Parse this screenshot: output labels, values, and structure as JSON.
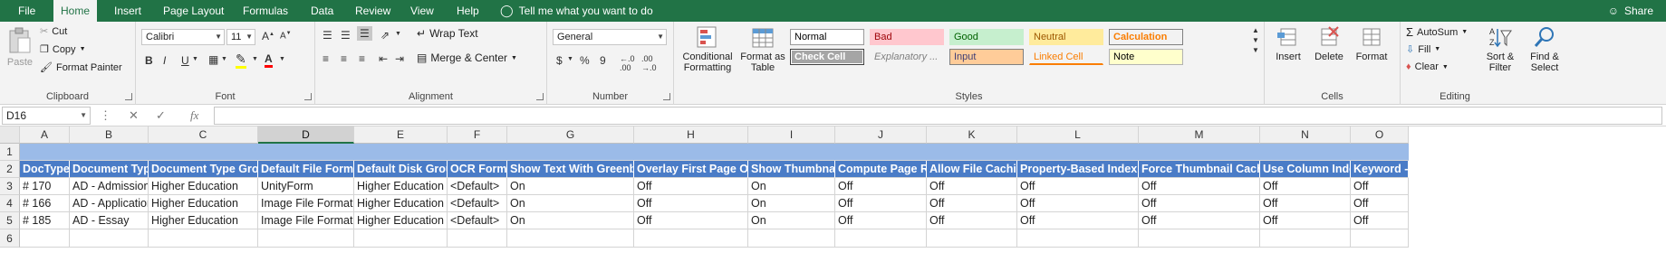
{
  "menu": {
    "tabs": [
      "File",
      "Home",
      "Insert",
      "Page Layout",
      "Formulas",
      "Data",
      "Review",
      "View",
      "Help"
    ],
    "active": "Home",
    "tell_me": "Tell me what you want to do",
    "share": "Share"
  },
  "ribbon": {
    "clipboard": {
      "label": "Clipboard",
      "paste": "Paste",
      "cut": "Cut",
      "copy": "Copy",
      "format_painter": "Format Painter"
    },
    "font": {
      "label": "Font",
      "font_name": "Calibri",
      "font_size": "11",
      "bold": "B",
      "italic": "I",
      "underline": "U"
    },
    "alignment": {
      "label": "Alignment",
      "wrap_text": "Wrap Text",
      "merge_center": "Merge & Center"
    },
    "number": {
      "label": "Number",
      "format": "General",
      "currency": "$",
      "percent": "%",
      "comma": "9"
    },
    "styles": {
      "label": "Styles",
      "conditional_formatting": "Conditional Formatting",
      "format_as_table": "Format as Table",
      "cells": [
        {
          "name": "Normal",
          "bg": "#ffffff",
          "fg": "#000000",
          "border": "#9a9a9a"
        },
        {
          "name": "Bad",
          "bg": "#ffc7ce",
          "fg": "#9c0006",
          "border": "#ffc7ce"
        },
        {
          "name": "Good",
          "bg": "#c6efce",
          "fg": "#006100",
          "border": "#c6efce"
        },
        {
          "name": "Neutral",
          "bg": "#ffeb9c",
          "fg": "#9c5700",
          "border": "#ffeb9c"
        },
        {
          "name": "Calculation",
          "bg": "#f2f2f2",
          "fg": "#fa7d00",
          "border": "#7f7f7f"
        },
        {
          "name": "Check Cell",
          "bg": "#a5a5a5",
          "fg": "#ffffff",
          "border": "#3f3f3f"
        },
        {
          "name": "Explanatory ...",
          "bg": "#f3f3f3",
          "fg": "#7f7f7f",
          "border": "#f3f3f3"
        },
        {
          "name": "Input",
          "bg": "#ffcc99",
          "fg": "#3f3f76",
          "border": "#7f7f7f"
        },
        {
          "name": "Linked Cell",
          "bg": "#f3f3f3",
          "fg": "#fa7d00",
          "border": "#f3f3f3"
        },
        {
          "name": "Note",
          "bg": "#ffffcc",
          "fg": "#000000",
          "border": "#b2b2b2"
        }
      ]
    },
    "cells_group": {
      "label": "Cells",
      "insert": "Insert",
      "delete": "Delete",
      "format": "Format"
    },
    "editing": {
      "label": "Editing",
      "autosum": "AutoSum",
      "fill": "Fill",
      "clear": "Clear",
      "sort_filter": "Sort & Filter",
      "find_select": "Find & Select"
    }
  },
  "formula_bar": {
    "name_box": "D16",
    "fx": "fx",
    "value": ""
  },
  "grid": {
    "columns": [
      "A",
      "B",
      "C",
      "D",
      "E",
      "F",
      "G",
      "H",
      "I",
      "J",
      "K",
      "L",
      "M",
      "N",
      "O"
    ],
    "selected_column": "D",
    "rows": [
      "1",
      "2",
      "3",
      "4",
      "5",
      "6"
    ],
    "headers": [
      "DocType #",
      "Document Type",
      "Document Type Group",
      "Default File Format",
      "Default Disk Group",
      "OCR Format",
      "Show Text With Greenbar",
      "Overlay First Page Only",
      "Show Thumbnails",
      "Compute Page Ref",
      "Allow File Caching",
      "Property-Based Indexing",
      "Force Thumbnail Caching",
      "Use Column Index",
      "Keyword - Ba"
    ],
    "data": [
      [
        "# 170",
        "AD - Admissions",
        "Higher Education",
        "UnityForm",
        "Higher Education",
        "<Default>",
        "On",
        "Off",
        "On",
        "Off",
        "Off",
        "Off",
        "Off",
        "Off",
        "Off"
      ],
      [
        "# 166",
        "AD - Application",
        "Higher Education",
        "Image File Format",
        "Higher Education",
        "<Default>",
        "On",
        "Off",
        "On",
        "Off",
        "Off",
        "Off",
        "Off",
        "Off",
        "Off"
      ],
      [
        "# 185",
        "AD - Essay",
        "Higher Education",
        "Image File Format",
        "Higher Education",
        "<Default>",
        "On",
        "Off",
        "On",
        "Off",
        "Off",
        "Off",
        "Off",
        "Off",
        "Off"
      ]
    ]
  }
}
